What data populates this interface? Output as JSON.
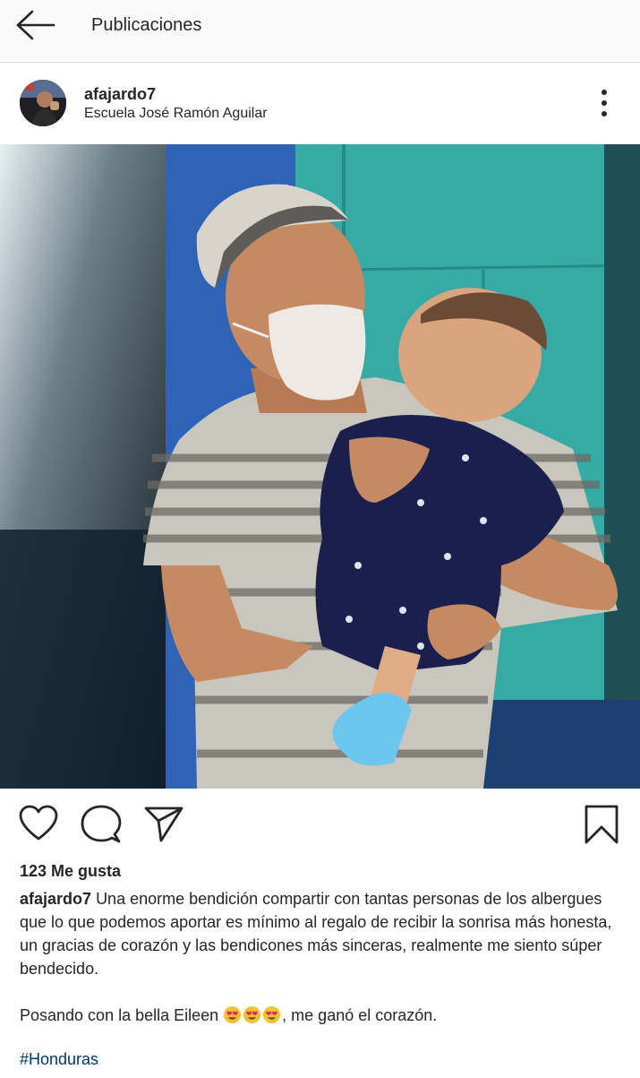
{
  "topbar": {
    "title": "Publicaciones",
    "back_icon": "arrow-left-icon"
  },
  "post": {
    "username": "afajardo7",
    "location": "Escuela José Ramón Aguilar",
    "more_icon": "more-vertical-icon",
    "photo_description": "photo",
    "actions": {
      "like_icon": "heart-icon",
      "comment_icon": "comment-icon",
      "share_icon": "send-icon",
      "save_icon": "bookmark-icon"
    },
    "likes": "123 Me gusta",
    "caption_user": "afajardo7",
    "caption_text": "Una enorme bendición compartir con tantas personas de los albergues que lo que podemos aportar es mínimo al regalo de recibir la sonrisa más honesta, un gracias de corazón y las bendicones más sinceras, realmente me siento súper bendecido.",
    "caption2_before": "Posando con la bella Eileen ",
    "caption2_emoji": "😍😍😍",
    "caption2_after": ", me ganó el corazón.",
    "hashtag": "#Honduras"
  }
}
